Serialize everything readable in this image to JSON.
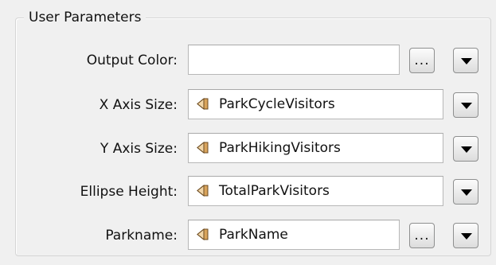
{
  "group": {
    "title": "User Parameters"
  },
  "rows": [
    {
      "label": "Output Color:",
      "value": "",
      "icon": "",
      "has_ellipsis": true
    },
    {
      "label": "X Axis Size:",
      "value": "ParkCycleVisitors",
      "icon": "attribute-icon",
      "has_ellipsis": false
    },
    {
      "label": "Y Axis Size:",
      "value": "ParkHikingVisitors",
      "icon": "attribute-icon",
      "has_ellipsis": false
    },
    {
      "label": "Ellipse Height:",
      "value": "TotalParkVisitors",
      "icon": "attribute-icon",
      "has_ellipsis": false
    },
    {
      "label": "Parkname:",
      "value": "ParkName",
      "icon": "attribute-icon",
      "has_ellipsis": true
    }
  ],
  "buttons": {
    "ellipsis_label": "..."
  },
  "colors": {
    "attribute_icon": "#b07a3c"
  }
}
